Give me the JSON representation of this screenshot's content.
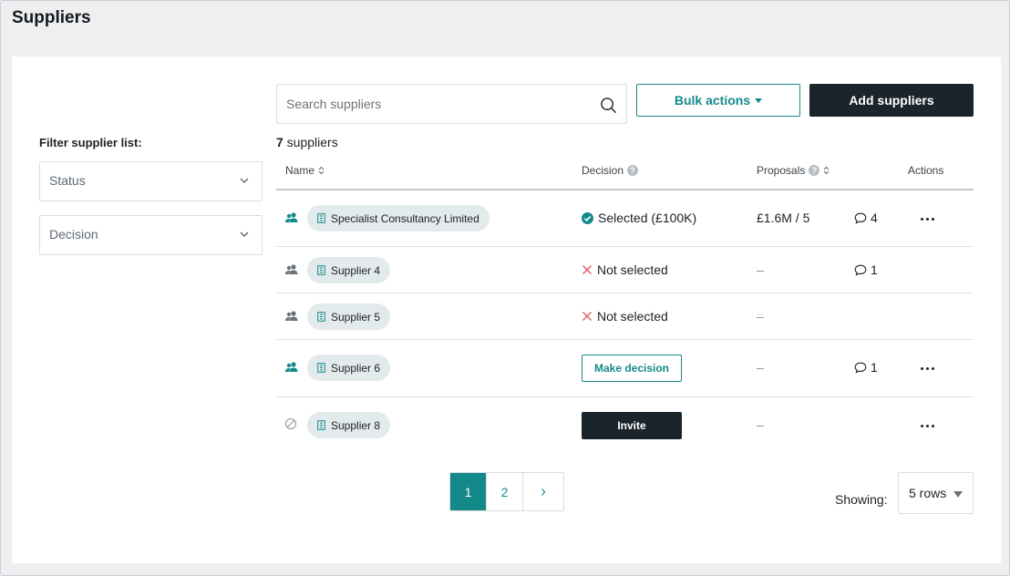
{
  "page": {
    "title": "Suppliers"
  },
  "filters": {
    "label": "Filter supplier list:",
    "status_placeholder": "Status",
    "decision_placeholder": "Decision"
  },
  "toolbar": {
    "search_placeholder": "Search suppliers",
    "bulk_label": "Bulk actions",
    "add_label": "Add suppliers"
  },
  "summary": {
    "count": "7",
    "count_suffix": " suppliers"
  },
  "table": {
    "headers": {
      "name": "Name",
      "decision": "Decision",
      "proposals": "Proposals",
      "actions": "Actions"
    },
    "rows": [
      {
        "name": "Specialist Consultancy Limited",
        "decision": "Selected (£100K)",
        "proposals": "£1.6M / 5",
        "comments": "4",
        "lead_icon": "users-icon-teal"
      },
      {
        "name": "Supplier 4",
        "decision": "Not selected",
        "proposals": "–",
        "comments": "1",
        "lead_icon": "users-icon-grey"
      },
      {
        "name": "Supplier 5",
        "decision": "Not selected",
        "proposals": "–",
        "lead_icon": "users-icon-grey"
      },
      {
        "name": "Supplier 6",
        "decision_button": "Make decision",
        "proposals": "–",
        "comments": "1",
        "lead_icon": "users-icon-teal"
      },
      {
        "name": "Supplier 8",
        "decision_button": "Invite",
        "proposals": "–",
        "lead_icon": "blocked-icon"
      }
    ]
  },
  "pagination": {
    "pages": [
      "1",
      "2"
    ],
    "active": "1",
    "next": "›"
  },
  "rows_per_page": {
    "label": "Showing:",
    "value": "5 rows"
  },
  "colors": {
    "accent": "#14898a",
    "dark": "#1a242b",
    "danger": "#e05a5a",
    "pill": "#e3eaec"
  }
}
